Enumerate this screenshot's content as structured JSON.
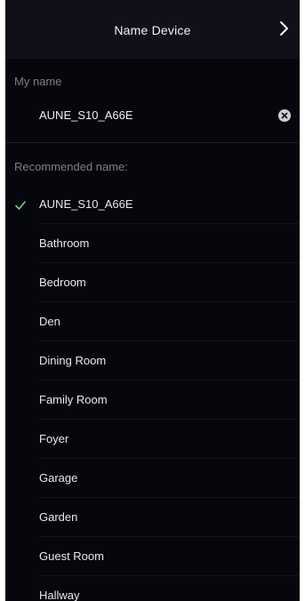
{
  "header": {
    "title": "Name Device",
    "next_icon": "chevron-right-icon"
  },
  "my_name": {
    "label": "My name",
    "value": "AUNE_S10_A66E",
    "clear_icon": "clear-circle-icon"
  },
  "recommended": {
    "label": "Recommended name:",
    "items": [
      {
        "label": "AUNE_S10_A66E",
        "selected": true
      },
      {
        "label": "Bathroom",
        "selected": false
      },
      {
        "label": "Bedroom",
        "selected": false
      },
      {
        "label": "Den",
        "selected": false
      },
      {
        "label": "Dining Room",
        "selected": false
      },
      {
        "label": "Family Room",
        "selected": false
      },
      {
        "label": "Foyer",
        "selected": false
      },
      {
        "label": "Garage",
        "selected": false
      },
      {
        "label": "Garden",
        "selected": false
      },
      {
        "label": "Guest Room",
        "selected": false
      },
      {
        "label": "Hallway",
        "selected": false
      }
    ]
  },
  "colors": {
    "background": "#06070d",
    "header": "#101118",
    "check": "#7fd08a",
    "muted_text": "#7d7f86"
  }
}
